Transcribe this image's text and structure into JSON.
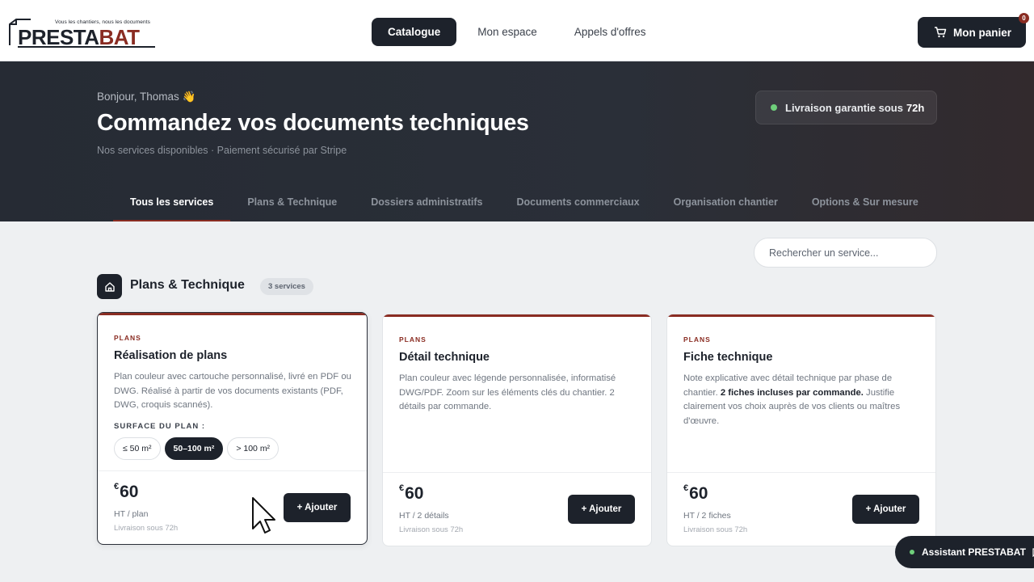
{
  "brand": {
    "tagline": "Vous les chantiers, nous les documents",
    "name_part1": "PRESTA",
    "name_part2": "BAT",
    "accent_color": "#8a2c22",
    "dark_color": "#1d222b"
  },
  "nav": {
    "items": [
      "Catalogue",
      "Mon espace",
      "Appels d'offres"
    ],
    "active_index": 0
  },
  "cart": {
    "label": "Mon panier",
    "icon": "cart-icon",
    "count": "0"
  },
  "hero": {
    "greeting": "Bonjour, Thomas 👋",
    "title": "Commandez vos documents techniques",
    "subtitle": "Nos services disponibles · Paiement sécurisé par Stripe",
    "delivery_text": "Livraison garantie sous",
    "delivery_highlight": "72h"
  },
  "tabs": [
    "Tous les services",
    "Plans & Technique",
    "Dossiers administratifs",
    "Documents commerciaux",
    "Organisation chantier",
    "Options & Sur mesure"
  ],
  "search": {
    "placeholder": "Rechercher un service..."
  },
  "section": {
    "title": "Plans & Technique",
    "count": "3 services",
    "icon": "home-icon"
  },
  "cards": [
    {
      "tag": "PLANS",
      "title": "Réalisation de plans",
      "description": "Plan couleur avec cartouche personnalisé, livré en PDF ou DWG. Réalisé à partir de vos documents existants (PDF, DWG, croquis scannés).",
      "surface_label": "SURFACE DU PLAN :",
      "surface_options": [
        "≤ 50 m²",
        "50–100 m²",
        "> 100 m²"
      ],
      "surface_selected": 1,
      "currency": "€",
      "price": "60",
      "unit": "HT / plan",
      "eta": "Livraison sous 72h",
      "add_label": "+ Ajouter"
    },
    {
      "tag": "PLANS",
      "title": "Détail technique",
      "description": "Plan couleur avec légende personnalisée, informatisé DWG/PDF. Zoom sur les éléments clés du chantier. 2 détails par commande.",
      "currency": "€",
      "price": "60",
      "unit": "HT / 2 détails",
      "eta": "Livraison sous 72h",
      "add_label": "+ Ajouter"
    },
    {
      "tag": "PLANS",
      "title": "Fiche technique",
      "description_before": "Note explicative avec détail technique par phase de chantier. ",
      "description_bold": "2 fiches incluses par commande.",
      "description_after": " Justifie clairement vos choix auprès de vos clients ou maîtres d'œuvre.",
      "currency": "€",
      "price": "60",
      "unit": "HT / 2 fiches",
      "eta": "Livraison sous 72h",
      "add_label": "+ Ajouter"
    }
  ],
  "assistant": {
    "label": "Assistant PRESTABAT"
  }
}
